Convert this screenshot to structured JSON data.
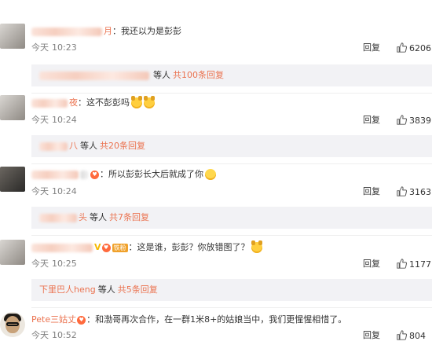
{
  "comments": [
    {
      "username_tail": "月",
      "text": "：我还以为是彭彭",
      "date": "今天",
      "time": "10:23",
      "reply_label": "回复",
      "likes": "6206",
      "sub": {
        "who_tail": "",
        "etc": "等人",
        "count": "共100条回复"
      }
    },
    {
      "username_tail": "夜",
      "text": "：这不彭彭吗",
      "date": "今天",
      "time": "10:24",
      "reply_label": "回复",
      "likes": "3839",
      "sub": {
        "who_tail": "八",
        "etc": "等人",
        "count": "共20条回复"
      }
    },
    {
      "username_tail": "",
      "text": "：所以彭彭长大后就成了你",
      "date": "今天",
      "time": "10:24",
      "reply_label": "回复",
      "likes": "3163",
      "sub": {
        "who_tail": "头",
        "etc": "等人",
        "count": "共7条回复"
      }
    },
    {
      "username_tail": "",
      "badge": "铁粉",
      "text": "：这是谁，彭彭？你放错图了？",
      "date": "今天",
      "time": "10:25",
      "reply_label": "回复",
      "likes": "1177",
      "sub": {
        "who_tail": "下里巴人heng",
        "etc": "等人",
        "count": "共5条回复"
      }
    },
    {
      "username_tail": "Pete三姑丈",
      "text": "：和渤哥再次合作，在一群1米8+的姑娘当中，我们更惺惺相惜了。",
      "date": "今天",
      "time": "10:52",
      "reply_label": "回复",
      "likes": "804"
    }
  ],
  "colors": {
    "username": "#eb7350",
    "meta": "#808080",
    "subbox_bg": "#f2f2f5"
  }
}
